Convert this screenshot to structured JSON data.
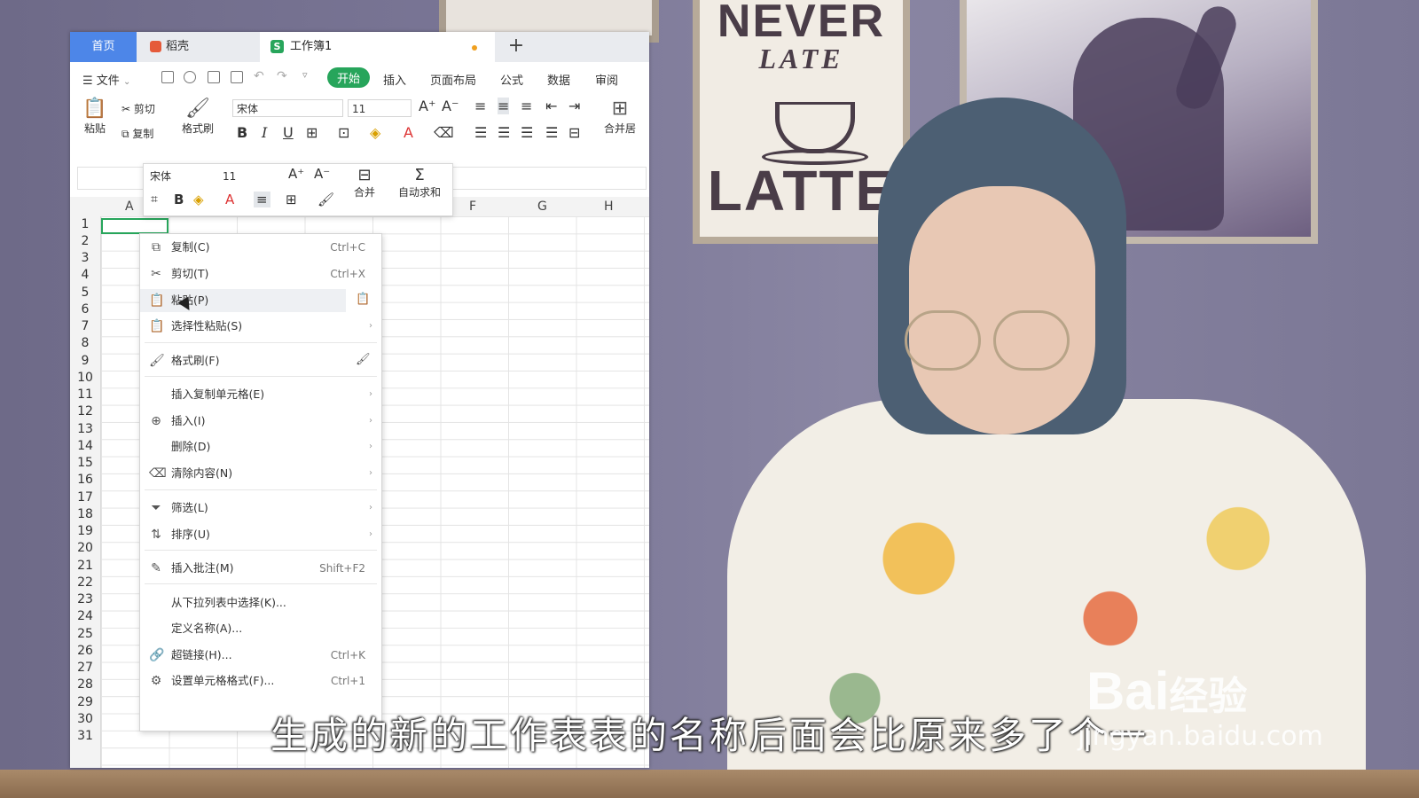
{
  "tabs": {
    "home": "首页",
    "docer": "稻壳",
    "workbook": "工作簿1",
    "new_tab": "+"
  },
  "menu": {
    "file": "文件",
    "tabs": [
      "开始",
      "插入",
      "页面布局",
      "公式",
      "数据",
      "审阅"
    ],
    "active_tab": "开始"
  },
  "ribbon": {
    "paste": "粘贴",
    "cut": "剪切",
    "copy": "复制",
    "format_painter": "格式刷",
    "font": "宋体",
    "size": "11",
    "merge": "合并居"
  },
  "mini_toolbar": {
    "font": "宋体",
    "size": "11",
    "merge": "合并",
    "autosum": "自动求和"
  },
  "grid": {
    "columns": [
      "A",
      "F",
      "G",
      "H"
    ],
    "rows": [
      "1",
      "2",
      "3",
      "4",
      "5",
      "6",
      "7",
      "8",
      "9",
      "10",
      "11",
      "12",
      "13",
      "14",
      "15",
      "16",
      "17",
      "18",
      "19",
      "20",
      "21",
      "22",
      "23",
      "24",
      "25",
      "26",
      "27",
      "28",
      "29",
      "30",
      "31"
    ]
  },
  "context_menu": [
    {
      "label": "复制(C)",
      "shortcut": "Ctrl+C",
      "icon": "copy-icon"
    },
    {
      "label": "剪切(T)",
      "shortcut": "Ctrl+X",
      "icon": "scissors-icon"
    },
    {
      "label": "粘贴(P)",
      "shortcut": "",
      "icon": "paste-icon"
    },
    {
      "label": "选择性粘贴(S)",
      "shortcut": "",
      "icon": "paste-special-icon"
    },
    {
      "label": "格式刷(F)",
      "shortcut": "",
      "icon": "brush-icon"
    },
    {
      "label": "插入复制单元格(E)",
      "shortcut": "",
      "icon": ""
    },
    {
      "label": "插入(I)",
      "shortcut": "",
      "icon": "insert-icon"
    },
    {
      "label": "删除(D)",
      "shortcut": "",
      "icon": ""
    },
    {
      "label": "清除内容(N)",
      "shortcut": "",
      "icon": "eraser-icon"
    },
    {
      "label": "筛选(L)",
      "shortcut": "",
      "icon": "filter-icon"
    },
    {
      "label": "排序(U)",
      "shortcut": "",
      "icon": "sort-icon"
    },
    {
      "label": "插入批注(M)",
      "shortcut": "Shift+F2",
      "icon": "comment-icon"
    },
    {
      "label": "从下拉列表中选择(K)...",
      "shortcut": "",
      "icon": ""
    },
    {
      "label": "定义名称(A)...",
      "shortcut": "",
      "icon": ""
    },
    {
      "label": "超链接(H)...",
      "shortcut": "Ctrl+K",
      "icon": "link-icon"
    },
    {
      "label": "设置单元格格式(F)...",
      "shortcut": "Ctrl+1",
      "icon": "format-cells-icon"
    }
  ],
  "poster": {
    "line1": "NEVER",
    "line2": "LATE",
    "line3": "LATTE"
  },
  "subtitle": "生成的新的工作表表的名称后面会比原来多了个一",
  "watermark": {
    "brand": "Bai",
    "brand2": "经验",
    "url": "jingyan.baidu.com"
  }
}
